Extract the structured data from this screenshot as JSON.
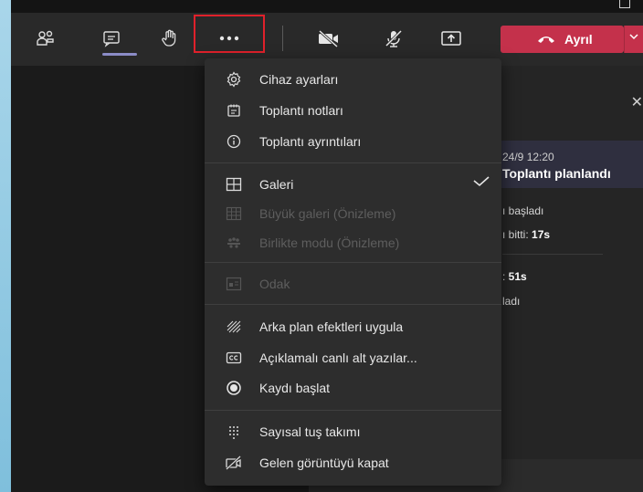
{
  "toolbar": {
    "leave_label": "Ayrıl"
  },
  "chat": {
    "time": "24/9 12:20",
    "title": "Toplantı planlandı",
    "line1": "ı başladı",
    "line2_prefix": "ı bitti: ",
    "line2_value": "17s",
    "line3_prefix": ": ",
    "line3_value": "51s",
    "line4": "ladı"
  },
  "menu": {
    "device_settings": "Cihaz ayarları",
    "meeting_notes": "Toplantı notları",
    "meeting_details": "Toplantı ayrıntıları",
    "gallery": "Galeri",
    "large_gallery": "Büyük galeri (Önizleme)",
    "together_mode": "Birlikte modu (Önizleme)",
    "focus": "Odak",
    "background_effects": "Arka plan efektleri uygula",
    "live_captions": "Açıklamalı canlı alt yazılar...",
    "start_recording": "Kaydı başlat",
    "dial_pad": "Sayısal tuş takımı",
    "turn_off_incoming_video": "Gelen görüntüyü kapat"
  },
  "colors": {
    "leave": "#c4314b",
    "highlight_box": "#e0212b",
    "accent": "#8b8cc7"
  }
}
